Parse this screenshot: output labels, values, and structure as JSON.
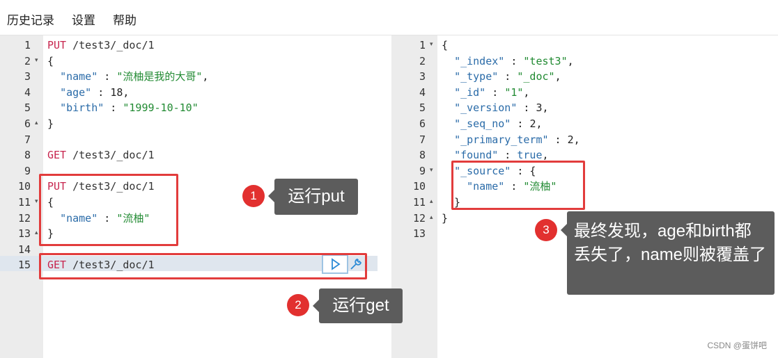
{
  "menu": {
    "history": "历史记录",
    "settings": "设置",
    "help": "帮助"
  },
  "left_editor": {
    "lines": [
      {
        "n": "1",
        "fold": "",
        "parts": [
          {
            "c": "k-method",
            "t": "PUT"
          },
          {
            "c": "k-url",
            "t": " /test3/_doc/1"
          }
        ]
      },
      {
        "n": "2",
        "fold": "▾",
        "parts": [
          {
            "c": "k-punc",
            "t": "{"
          }
        ]
      },
      {
        "n": "3",
        "fold": "",
        "parts": [
          {
            "c": "k-punc",
            "t": "  "
          },
          {
            "c": "k-key",
            "t": "\"name\""
          },
          {
            "c": "k-punc",
            "t": " : "
          },
          {
            "c": "k-str",
            "t": "\"流柚是我的大哥\""
          },
          {
            "c": "k-punc",
            "t": ","
          }
        ]
      },
      {
        "n": "4",
        "fold": "",
        "parts": [
          {
            "c": "k-punc",
            "t": "  "
          },
          {
            "c": "k-key",
            "t": "\"age\""
          },
          {
            "c": "k-punc",
            "t": " : "
          },
          {
            "c": "k-num",
            "t": "18"
          },
          {
            "c": "k-punc",
            "t": ","
          }
        ]
      },
      {
        "n": "5",
        "fold": "",
        "parts": [
          {
            "c": "k-punc",
            "t": "  "
          },
          {
            "c": "k-key",
            "t": "\"birth\""
          },
          {
            "c": "k-punc",
            "t": " : "
          },
          {
            "c": "k-str",
            "t": "\"1999-10-10\""
          }
        ]
      },
      {
        "n": "6",
        "fold": "▴",
        "parts": [
          {
            "c": "k-punc",
            "t": "}"
          }
        ]
      },
      {
        "n": "7",
        "fold": "",
        "parts": []
      },
      {
        "n": "8",
        "fold": "",
        "parts": [
          {
            "c": "k-method",
            "t": "GET"
          },
          {
            "c": "k-url",
            "t": " /test3/_doc/1"
          }
        ]
      },
      {
        "n": "9",
        "fold": "",
        "parts": []
      },
      {
        "n": "10",
        "fold": "",
        "parts": [
          {
            "c": "k-method",
            "t": "PUT"
          },
          {
            "c": "k-url",
            "t": " /test3/_doc/1"
          }
        ]
      },
      {
        "n": "11",
        "fold": "▾",
        "parts": [
          {
            "c": "k-punc",
            "t": "{"
          }
        ]
      },
      {
        "n": "12",
        "fold": "",
        "parts": [
          {
            "c": "k-punc",
            "t": "  "
          },
          {
            "c": "k-key",
            "t": "\"name\""
          },
          {
            "c": "k-punc",
            "t": " : "
          },
          {
            "c": "k-str",
            "t": "\"流柚\""
          }
        ]
      },
      {
        "n": "13",
        "fold": "▴",
        "parts": [
          {
            "c": "k-punc",
            "t": "}"
          }
        ]
      },
      {
        "n": "14",
        "fold": "",
        "parts": []
      },
      {
        "n": "15",
        "fold": "",
        "parts": [
          {
            "c": "k-method",
            "t": "GET"
          },
          {
            "c": "k-url",
            "t": " /test3/_doc/1"
          }
        ]
      }
    ]
  },
  "right_editor": {
    "lines": [
      {
        "n": "1",
        "fold": "▾",
        "parts": [
          {
            "c": "k-punc",
            "t": "{"
          }
        ]
      },
      {
        "n": "2",
        "fold": "",
        "parts": [
          {
            "c": "k-punc",
            "t": "  "
          },
          {
            "c": "k-key",
            "t": "\"_index\""
          },
          {
            "c": "k-punc",
            "t": " : "
          },
          {
            "c": "k-str",
            "t": "\"test3\""
          },
          {
            "c": "k-punc",
            "t": ","
          }
        ]
      },
      {
        "n": "3",
        "fold": "",
        "parts": [
          {
            "c": "k-punc",
            "t": "  "
          },
          {
            "c": "k-key",
            "t": "\"_type\""
          },
          {
            "c": "k-punc",
            "t": " : "
          },
          {
            "c": "k-str",
            "t": "\"_doc\""
          },
          {
            "c": "k-punc",
            "t": ","
          }
        ]
      },
      {
        "n": "4",
        "fold": "",
        "parts": [
          {
            "c": "k-punc",
            "t": "  "
          },
          {
            "c": "k-key",
            "t": "\"_id\""
          },
          {
            "c": "k-punc",
            "t": " : "
          },
          {
            "c": "k-str",
            "t": "\"1\""
          },
          {
            "c": "k-punc",
            "t": ","
          }
        ]
      },
      {
        "n": "5",
        "fold": "",
        "parts": [
          {
            "c": "k-punc",
            "t": "  "
          },
          {
            "c": "k-key",
            "t": "\"_version\""
          },
          {
            "c": "k-punc",
            "t": " : "
          },
          {
            "c": "k-num",
            "t": "3"
          },
          {
            "c": "k-punc",
            "t": ","
          }
        ]
      },
      {
        "n": "6",
        "fold": "",
        "parts": [
          {
            "c": "k-punc",
            "t": "  "
          },
          {
            "c": "k-key",
            "t": "\"_seq_no\""
          },
          {
            "c": "k-punc",
            "t": " : "
          },
          {
            "c": "k-num",
            "t": "2"
          },
          {
            "c": "k-punc",
            "t": ","
          }
        ]
      },
      {
        "n": "7",
        "fold": "",
        "parts": [
          {
            "c": "k-punc",
            "t": "  "
          },
          {
            "c": "k-key",
            "t": "\"_primary_term\""
          },
          {
            "c": "k-punc",
            "t": " : "
          },
          {
            "c": "k-num",
            "t": "2"
          },
          {
            "c": "k-punc",
            "t": ","
          }
        ]
      },
      {
        "n": "8",
        "fold": "",
        "parts": [
          {
            "c": "k-punc",
            "t": "  "
          },
          {
            "c": "k-key",
            "t": "\"found\""
          },
          {
            "c": "k-punc",
            "t": " : "
          },
          {
            "c": "k-bool",
            "t": "true"
          },
          {
            "c": "k-punc",
            "t": ","
          }
        ]
      },
      {
        "n": "9",
        "fold": "▾",
        "parts": [
          {
            "c": "k-punc",
            "t": "  "
          },
          {
            "c": "k-key",
            "t": "\"_source\""
          },
          {
            "c": "k-punc",
            "t": " : {"
          }
        ]
      },
      {
        "n": "10",
        "fold": "",
        "parts": [
          {
            "c": "k-punc",
            "t": "    "
          },
          {
            "c": "k-key",
            "t": "\"name\""
          },
          {
            "c": "k-punc",
            "t": " : "
          },
          {
            "c": "k-str",
            "t": "\"流柚\""
          }
        ]
      },
      {
        "n": "11",
        "fold": "▴",
        "parts": [
          {
            "c": "k-punc",
            "t": "  }"
          }
        ]
      },
      {
        "n": "12",
        "fold": "▴",
        "parts": [
          {
            "c": "k-punc",
            "t": "}"
          }
        ]
      },
      {
        "n": "13",
        "fold": "",
        "parts": []
      }
    ]
  },
  "annotations": {
    "a1": {
      "num": "1",
      "text": "运行put"
    },
    "a2": {
      "num": "2",
      "text": "运行get"
    },
    "a3": {
      "num": "3",
      "text": "最终发现，age和birth都丢失了，name则被覆盖了"
    }
  },
  "icons": {
    "run": "play-icon",
    "settings": "wrench-icon"
  },
  "watermark": "CSDN @蛋饼吧"
}
